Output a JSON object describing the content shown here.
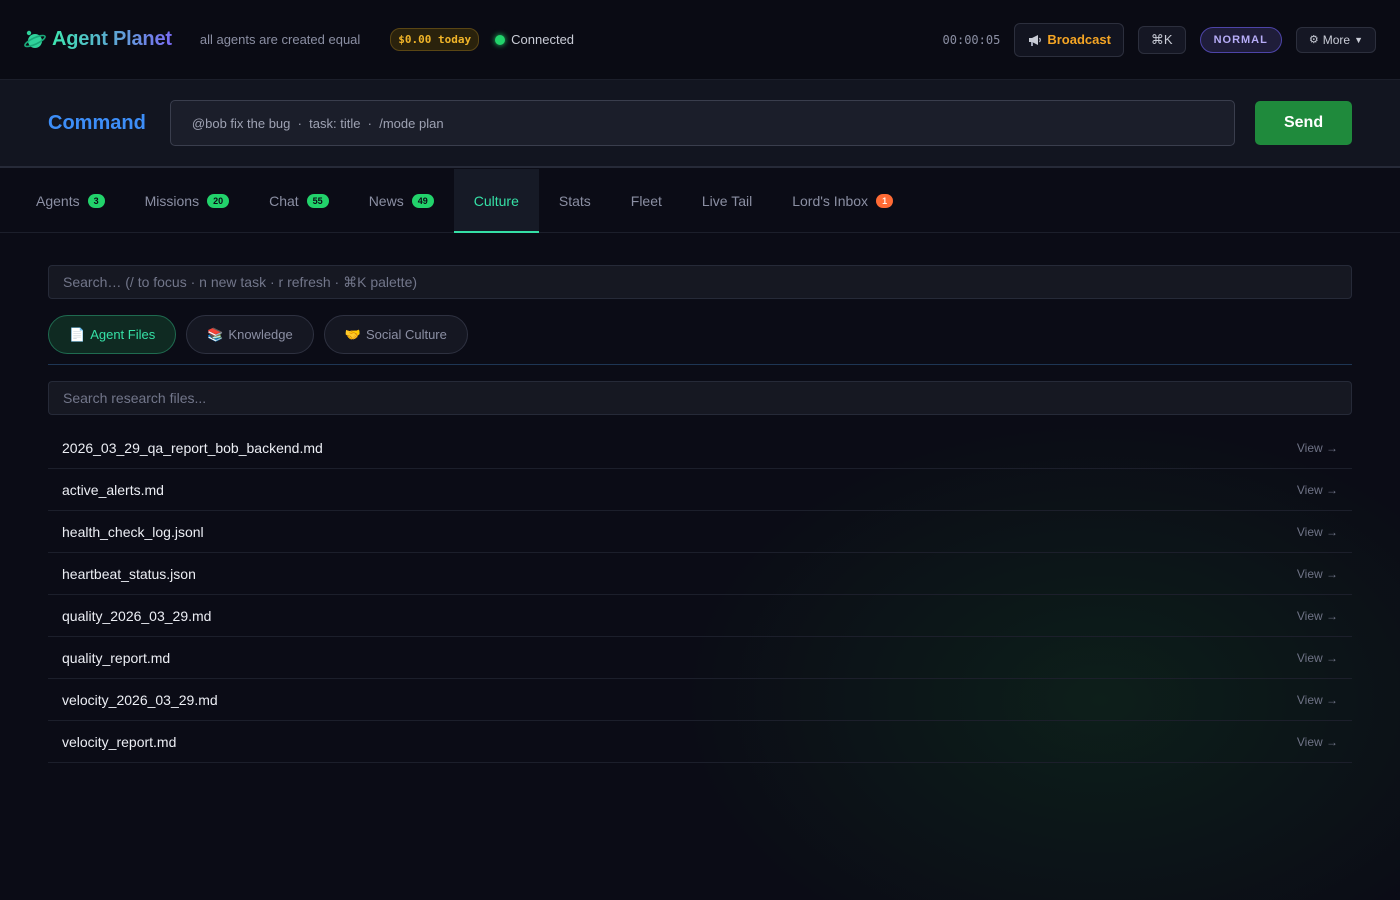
{
  "header": {
    "app_name": "Agent Planet",
    "tagline": "all agents are created equal",
    "cost": "$0.00 today",
    "status": "Connected",
    "timer": "00:00:05",
    "broadcast_label": "Broadcast",
    "shortcut_label": "⌘K",
    "mode": "NORMAL",
    "more_label": "More"
  },
  "command": {
    "label": "Command",
    "placeholder": "@bob fix the bug  ·  task: title  ·  /mode plan",
    "send_label": "Send"
  },
  "tabs": [
    {
      "label": "Agents",
      "count": "3"
    },
    {
      "label": "Missions",
      "count": "20"
    },
    {
      "label": "Chat",
      "count": "55"
    },
    {
      "label": "News",
      "count": "49"
    },
    {
      "label": "Culture"
    },
    {
      "label": "Stats"
    },
    {
      "label": "Fleet"
    },
    {
      "label": "Live Tail"
    },
    {
      "label": "Lord's Inbox",
      "count": "1"
    }
  ],
  "active_tab": "Culture",
  "search": {
    "placeholder": "Search… (/ to focus · n new task · r refresh · ⌘K palette)"
  },
  "subtabs": [
    {
      "label": "Agent Files",
      "icon": "document-icon"
    },
    {
      "label": "Knowledge",
      "icon": "books-icon"
    },
    {
      "label": "Social Culture",
      "icon": "handshake-icon"
    }
  ],
  "file_search": {
    "placeholder": "Search research files..."
  },
  "files": [
    {
      "name": "2026_03_29_qa_report_bob_backend.md",
      "action": "View →"
    },
    {
      "name": "active_alerts.md",
      "action": "View →"
    },
    {
      "name": "health_check_log.jsonl",
      "action": "View →"
    },
    {
      "name": "heartbeat_status.json",
      "action": "View →"
    },
    {
      "name": "quality_2026_03_29.md",
      "action": "View →"
    },
    {
      "name": "quality_report.md",
      "action": "View →"
    },
    {
      "name": "velocity_2026_03_29.md",
      "action": "View →"
    },
    {
      "name": "velocity_report.md",
      "action": "View →"
    }
  ],
  "colors": {
    "accent": "#35e0a6",
    "command_accent": "#3d8ef8",
    "send": "#1f8a3c",
    "broadcast": "#f5a524",
    "badge_green": "#22d36b",
    "badge_orange": "#ff6b35"
  }
}
